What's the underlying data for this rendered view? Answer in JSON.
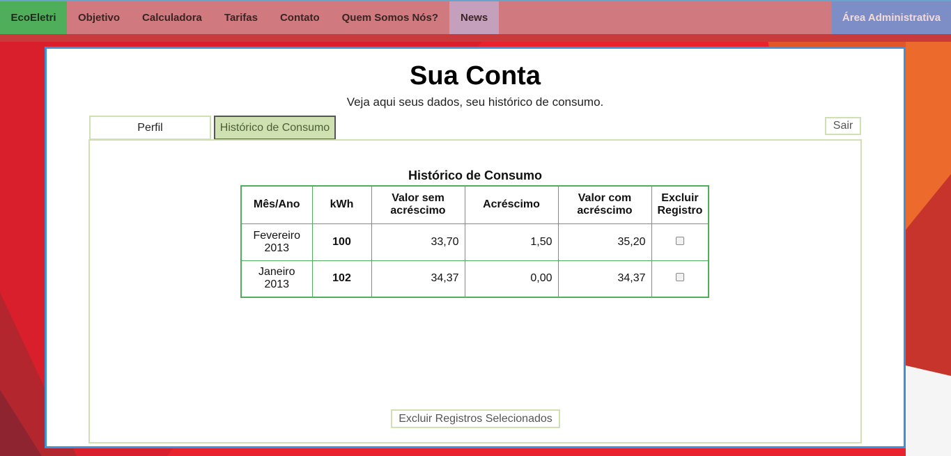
{
  "nav": {
    "brand": "EcoEletri",
    "items": [
      {
        "label": "Objetivo"
      },
      {
        "label": "Calculadora"
      },
      {
        "label": "Tarifas"
      },
      {
        "label": "Contato"
      },
      {
        "label": "Quem Somos Nós?"
      },
      {
        "label": "News"
      }
    ],
    "admin": "Área Administrativa"
  },
  "page": {
    "title": "Sua Conta",
    "subtitle": "Veja aqui seus dados, seu histórico de consumo."
  },
  "tabs": {
    "profile": "Perfil",
    "history": "Histórico de Consumo"
  },
  "logout_label": "Sair",
  "history": {
    "title": "Histórico de Consumo",
    "headers": {
      "month": "Mês/Ano",
      "kwh": "kWh",
      "value_no_add_1": "Valor sem",
      "value_no_add_2": "acréscimo",
      "addition": "Acréscimo",
      "value_with_add_1": "Valor com",
      "value_with_add_2": "acréscimo",
      "delete_1": "Excluir",
      "delete_2": "Registro"
    },
    "rows": [
      {
        "month": "Fevereiro",
        "year": "2013",
        "kwh": "100",
        "value_no_add": "33,70",
        "addition": "1,50",
        "value_with_add": "35,20"
      },
      {
        "month": "Janeiro",
        "year": "2013",
        "kwh": "102",
        "value_no_add": "34,37",
        "addition": "0,00",
        "value_with_add": "34,37"
      }
    ],
    "delete_button": "Excluir Registros Selecionados"
  },
  "colors": {
    "brand_green": "#4fae5a",
    "card_border": "#3e91d6",
    "tab_green": "#cfe0b1",
    "admin_blue": "#7d8dc6"
  }
}
